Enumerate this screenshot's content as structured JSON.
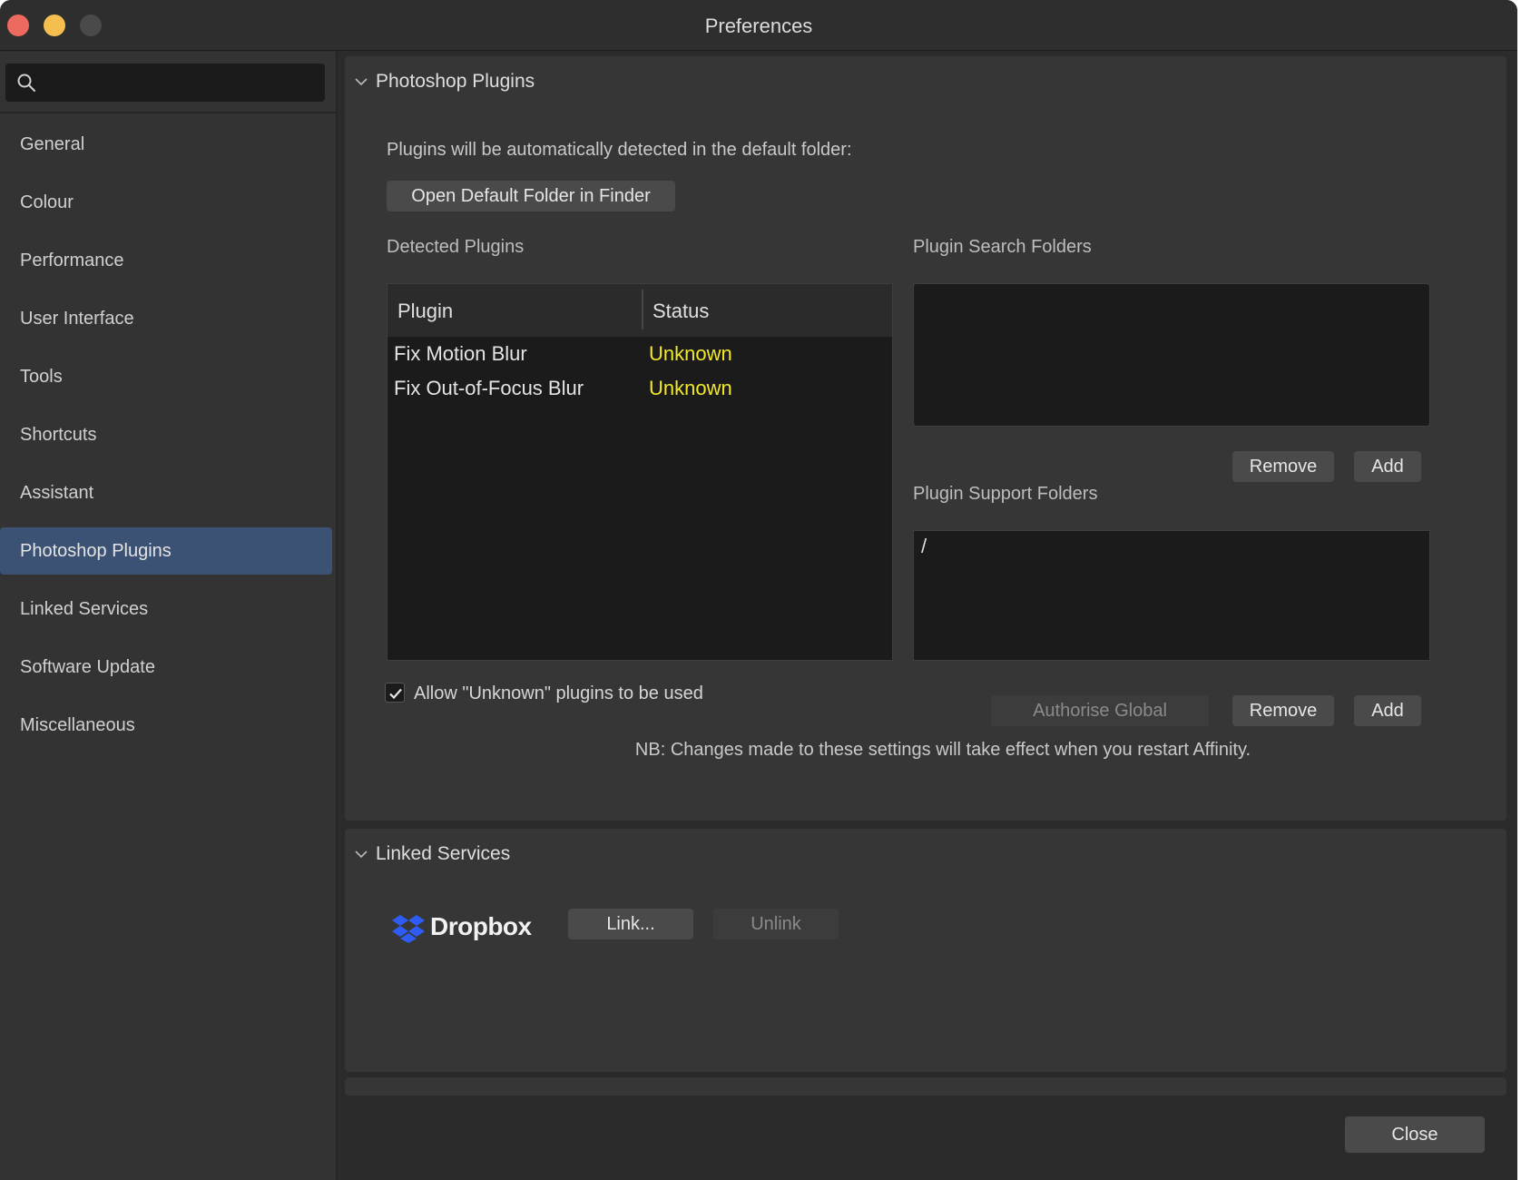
{
  "window": {
    "title": "Preferences"
  },
  "search": {
    "placeholder": "",
    "value": ""
  },
  "sidebar": {
    "items": [
      {
        "label": "General"
      },
      {
        "label": "Colour"
      },
      {
        "label": "Performance"
      },
      {
        "label": "User Interface"
      },
      {
        "label": "Tools"
      },
      {
        "label": "Shortcuts"
      },
      {
        "label": "Assistant"
      },
      {
        "label": "Photoshop Plugins",
        "active": true
      },
      {
        "label": "Linked Services"
      },
      {
        "label": "Software Update"
      },
      {
        "label": "Miscellaneous"
      }
    ]
  },
  "plugins_panel": {
    "title": "Photoshop Plugins",
    "info": "Plugins will be automatically detected in the default folder:",
    "open_folder_button": "Open Default Folder in Finder",
    "detected_label": "Detected Plugins",
    "table": {
      "columns": [
        "Plugin",
        "Status"
      ],
      "rows": [
        {
          "plugin": "Fix Motion Blur",
          "status": "Unknown"
        },
        {
          "plugin": "Fix Out-of-Focus Blur",
          "status": "Unknown"
        }
      ]
    },
    "search_folders_label": "Plugin Search Folders",
    "search_folders": [],
    "search_remove_button": "Remove",
    "search_add_button": "Add",
    "support_folders_label": "Plugin Support Folders",
    "support_folders": [
      "/"
    ],
    "allow_unknown_label": "Allow \"Unknown\" plugins to be used",
    "allow_unknown_checked": true,
    "authorise_global_button": "Authorise Global",
    "support_remove_button": "Remove",
    "support_add_button": "Add",
    "note": "NB: Changes made to these settings will take effect when you restart Affinity."
  },
  "services_panel": {
    "title": "Linked Services",
    "service_name": "Dropbox",
    "link_button": "Link...",
    "unlink_button": "Unlink"
  },
  "footer": {
    "close_button": "Close"
  },
  "colors": {
    "accent_selection": "#3c5275",
    "status_unknown": "#f2e82c",
    "dropbox_blue": "#2f5cf5"
  }
}
